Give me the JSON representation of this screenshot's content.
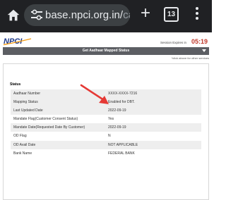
{
  "browser": {
    "url_host": "base.npci.org.in/",
    "url_path": "cata",
    "tab_count": "13",
    "icons": [
      "home-icon",
      "tune-icon",
      "plus-icon",
      "tabs-icon",
      "more-vert-icon"
    ]
  },
  "header": {
    "logo_text": "NPCI",
    "session_label": "Session Expires in",
    "timer": "05:19",
    "title": "Get Aadhaar Mapped Status",
    "subnote": "*click above for other services"
  },
  "status": {
    "heading": "Status",
    "rows": [
      {
        "label": "Aadhaar Number",
        "value": "XXXX-XXXX-7216"
      },
      {
        "label": "Mapping Status",
        "value": "Enabled for DBT."
      },
      {
        "label": "Last Updated Date",
        "value": "2022-09-19"
      },
      {
        "label": "Mandate Flag(Customer Consent Status)",
        "value": "Yes"
      },
      {
        "label": "Mandate Date(Requested Date By Customer)",
        "value": "2022-09-19"
      },
      {
        "label": "OD Flag",
        "value": "N"
      },
      {
        "label": "OD Avail Date",
        "value": "NOT APPLICABLE"
      },
      {
        "label": "Bank Name",
        "value": "FEDERAL BANK"
      }
    ]
  },
  "colors": {
    "chrome_bg": "#202124",
    "titlebar_bg": "#5c5e63",
    "timer": "#c0392b",
    "arrow": "#e53935"
  }
}
